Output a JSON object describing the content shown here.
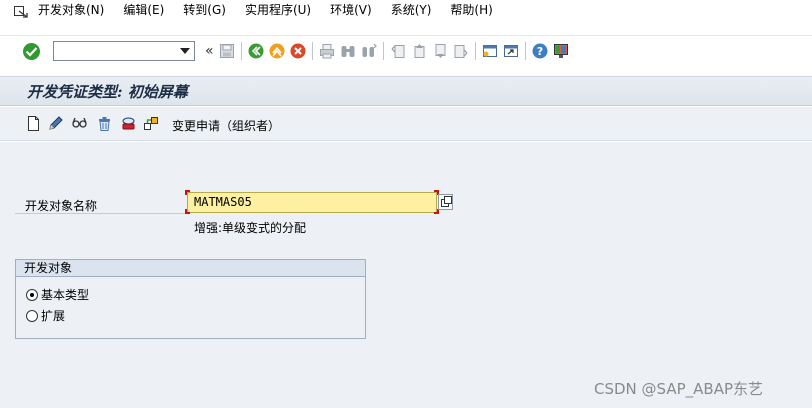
{
  "menu": {
    "items": [
      "开发对象(N)",
      "编辑(E)",
      "转到(G)",
      "实用程序(U)",
      "环境(V)",
      "系统(Y)",
      "帮助(H)"
    ]
  },
  "toolbar": {
    "command_field": "",
    "history_glyph": "«"
  },
  "title": "开发凭证类型: 初始屏幕",
  "app_toolbar": {
    "change_request_label": "变更申请（组织者）"
  },
  "form": {
    "object_name_label": "开发对象名称",
    "object_name_value": "MATMAS05",
    "object_description": "增强:单级变式的分配"
  },
  "group": {
    "title": "开发对象",
    "options": [
      {
        "label": "基本类型",
        "selected": true
      },
      {
        "label": "扩展",
        "selected": false
      }
    ]
  },
  "watermark": "CSDN @SAP_ABAP东艺",
  "colors": {
    "accent_input": "#fdf0a0",
    "required_marker": "#d01010",
    "title_text": "#1c2d44"
  }
}
